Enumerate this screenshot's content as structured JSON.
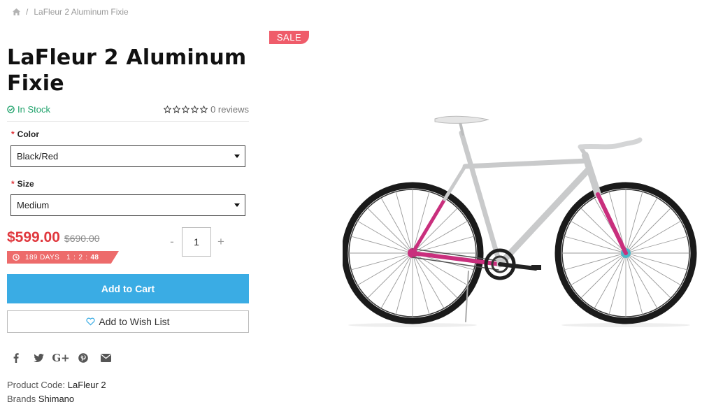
{
  "breadcrumb": {
    "current": "LaFleur 2 Aluminum Fixie"
  },
  "product": {
    "title": "LaFleur 2 Aluminum Fixie",
    "stock_status": "In Stock",
    "reviews": "0 reviews",
    "rating": 0,
    "sale_badge": "SALE",
    "options": {
      "color": {
        "label": "Color",
        "required": "*",
        "value": "Black/Red"
      },
      "size": {
        "label": "Size",
        "required": "*",
        "value": "Medium"
      }
    },
    "price": {
      "current": "$599.00",
      "old": "$690.00"
    },
    "quantity": {
      "value": "1",
      "minus": "-",
      "plus": "+"
    },
    "countdown": {
      "days": "189 DAYS",
      "h": "1",
      "m": "2",
      "s": "48"
    },
    "add_to_cart": "Add to Cart",
    "wishlist": "Add to Wish List",
    "product_code_label": "Product Code:",
    "product_code": "LaFleur 2",
    "brand_label": "Brands",
    "brand": "Shimano"
  },
  "social": [
    "facebook-icon",
    "twitter-icon",
    "google-plus-icon",
    "pinterest-icon",
    "email-icon"
  ],
  "colors": {
    "accent": "#3aace4",
    "price": "#e0383e",
    "sale": "#ef5c6a",
    "stock": "#1fa26b",
    "frame_tube": "#cc2f7a"
  }
}
